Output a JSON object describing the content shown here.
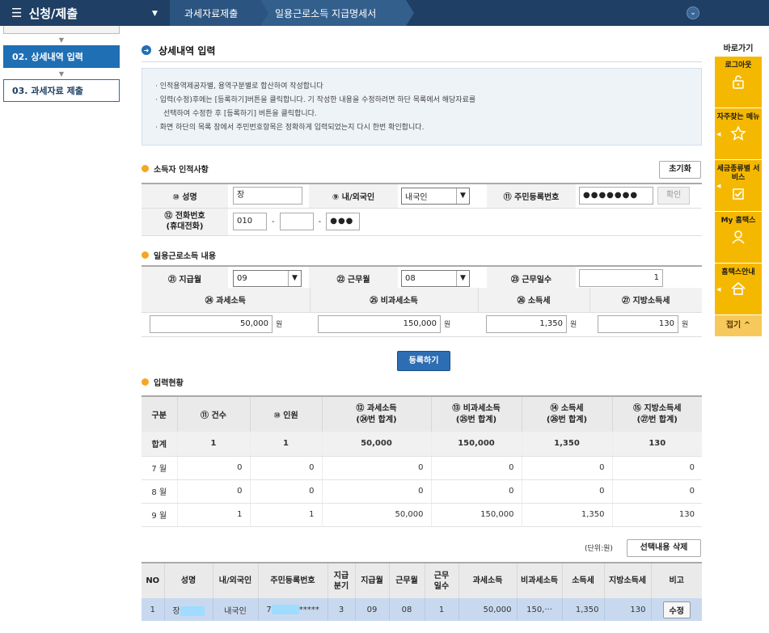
{
  "topbar": {
    "menu_title": "신청/제출",
    "breadcrumb": [
      "과세자료제출",
      "일용근로소득 지급명세서"
    ]
  },
  "steps": [
    {
      "label": "02. 상세내역 입력",
      "active": true
    },
    {
      "label": "03. 과세자료 제출",
      "active": false
    }
  ],
  "quick": {
    "title": "바로가기",
    "items": [
      {
        "label": "로그아웃",
        "icon": "unlock-icon"
      },
      {
        "label": "자주찾는 메뉴",
        "icon": "star-icon"
      },
      {
        "label": "세금종류별 서비스",
        "icon": "checkbox-icon"
      },
      {
        "label": "My 홈택스",
        "icon": "person-icon"
      },
      {
        "label": "홈택스안내",
        "icon": "home-icon"
      }
    ],
    "fold": "접기 ^"
  },
  "page": {
    "title": "상세내역 입력",
    "notice": [
      "인적용역제공자별, 용역구분별로 합산하여 작성합니다",
      "입력(수정)후에는 [등록하기]버튼을 클릭합니다. 기 작성한 내용을 수정하려면 하단 목록에서 해당자료를",
      "선택하여 수정한 후 [등록하기] 버튼을 클릭합니다.",
      "화면 하단의 목록 창에서 주민번호항목은 정확하게 입력되었는지 다시 한번 확인합니다."
    ]
  },
  "earner": {
    "section": "소득자 인적사항",
    "reset": "초기화",
    "name_label": "⑩ 성명",
    "name_value": "장",
    "nat_label": "⑨ 내/외국인",
    "nat_value": "내국인",
    "rrn_label": "⑪ 주민등록번호",
    "rrn_value": "●●●●●●●",
    "confirm": "확인",
    "phone_label": "⑫ 전화번호",
    "phone_label2": "(휴대전화)",
    "phone1": "010",
    "phone2": "",
    "phone3": "●●●"
  },
  "work": {
    "section": "일용근로소득 내용",
    "pay_month_label": "㉑ 지급월",
    "pay_month": "09",
    "work_month_label": "㉒ 근무월",
    "work_month": "08",
    "days_label": "㉓ 근무일수",
    "days": "1",
    "taxable_label": "㉔ 과세소득",
    "nontax_label": "㉕ 비과세소득",
    "tax_label": "㉖ 소득세",
    "local_label": "㉗ 지방소득세",
    "taxable": "50,000",
    "nontax": "150,000",
    "tax": "1,350",
    "local": "130",
    "unit": "원",
    "register": "등록하기"
  },
  "status": {
    "section": "입력현황",
    "headers": [
      "구분",
      "⑪ 건수",
      "⑩ 인원",
      "⑫ 과세소득",
      "(㉔번 합계)",
      "⑬ 비과세소득",
      "(㉕번 합계)",
      "⑭ 소득세",
      "(㉖번 합계)",
      "⑮ 지방소득세",
      "(㉗번 합계)"
    ],
    "sum": [
      "합계",
      "1",
      "1",
      "50,000",
      "150,000",
      "1,350",
      "130"
    ],
    "rows": [
      [
        "7 월",
        "0",
        "0",
        "0",
        "0",
        "0",
        "0"
      ],
      [
        "8 월",
        "0",
        "0",
        "0",
        "0",
        "0",
        "0"
      ],
      [
        "9 월",
        "1",
        "1",
        "50,000",
        "150,000",
        "1,350",
        "130"
      ]
    ]
  },
  "list": {
    "unit_note": "(단위:원)",
    "delete": "선택내용 삭제",
    "headers": [
      "NO",
      "성명",
      "내/외국인",
      "주민등록번호",
      "지급",
      "분기",
      "지급월",
      "근무월",
      "근무",
      "일수",
      "과세소득",
      "비과세소득",
      "소득세",
      "지방소득세",
      "비고"
    ],
    "row": {
      "no": "1",
      "name": "장",
      "nat": "내국인",
      "rrn_prefix": "7",
      "rrn_suffix": "*****",
      "quarter": "3",
      "pay_month": "09",
      "work_month": "08",
      "days": "1",
      "taxable": "50,000",
      "nontax": "150,···",
      "tax": "1,350",
      "local": "130",
      "edit": "수정"
    }
  },
  "colors": {
    "topbar": "#1f3f64",
    "step_active": "#1f6fb5",
    "quick_bg": "#f5b800",
    "row_selected": "#c8d9ef"
  }
}
